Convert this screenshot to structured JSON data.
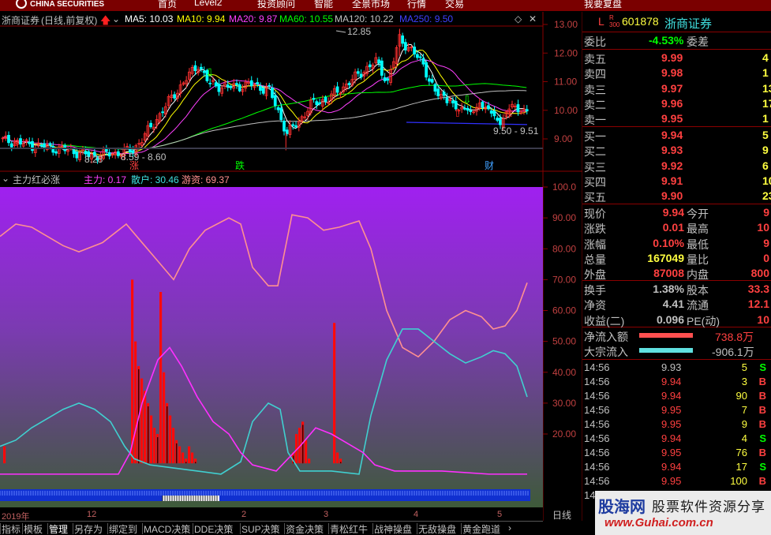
{
  "menu_bar": {
    "brand": "CHINA SECURITIES",
    "items": [
      "首页",
      "Level2",
      "投资顾问",
      "智能",
      "全景市场",
      "行情",
      "交易",
      "我要复盘"
    ]
  },
  "main_chart": {
    "title": "浙商证券",
    "period": "(日线,前复权)",
    "ma": [
      {
        "label": "MA5: 10.03",
        "color": "#ffffff"
      },
      {
        "label": "MA10: 9.94",
        "color": "#ffff00"
      },
      {
        "label": "MA20: 9.87",
        "color": "#ff40ff"
      },
      {
        "label": "MA60: 10.55",
        "color": "#00ff00"
      },
      {
        "label": "MA120: 10.22",
        "color": "#c0c0c0"
      },
      {
        "label": "MA250: 9.50",
        "color": "#4040ff"
      }
    ],
    "y_labels": [
      "13.00",
      "12.00",
      "11.00",
      "10.00",
      "9.00"
    ],
    "annotations": {
      "high": "12.85",
      "low": "8.28",
      "range1": "8.59 - 8.60",
      "range2": "9.50 - 9.51",
      "badge_zhang": "涨",
      "badge_die": "跌",
      "badge_cai": "财"
    }
  },
  "sub_chart": {
    "title": "主力红必涨",
    "legend": [
      {
        "label": "主力: 0.17",
        "color": "#ff40ff"
      },
      {
        "label": "散户: 30.46",
        "color": "#40e0e0"
      },
      {
        "label": "游资: 69.37",
        "color": "#ff9090"
      }
    ],
    "y_labels": [
      "100.0",
      "90.00",
      "80.00",
      "70.00",
      "60.00",
      "50.00",
      "40.00",
      "30.00",
      "20.00"
    ]
  },
  "x_axis": {
    "labels": [
      "2019年",
      "12",
      "2",
      "3",
      "4",
      "5"
    ],
    "period_button": "日线"
  },
  "bottom_tabs": [
    "指标",
    "模板",
    "管理",
    "另存为",
    "绑定到",
    "MACD决策",
    "DDE决策",
    "SUP决策",
    "资金决策",
    "青松红牛",
    "战神操盘",
    "无敌操盘",
    "黄金跑道"
  ],
  "quote_panel": {
    "market_flag": "L",
    "index_tag": "R 300",
    "code": "601878",
    "name": "浙商证券",
    "weibi_label": "委比",
    "weibi_value": "-4.53%",
    "weicha_label": "委差",
    "sell": [
      {
        "label": "卖五",
        "price": "9.99",
        "vol": "4"
      },
      {
        "label": "卖四",
        "price": "9.98",
        "vol": "1"
      },
      {
        "label": "卖三",
        "price": "9.97",
        "vol": "13"
      },
      {
        "label": "卖二",
        "price": "9.96",
        "vol": "17"
      },
      {
        "label": "卖一",
        "price": "9.95",
        "vol": "1"
      }
    ],
    "buy": [
      {
        "label": "买一",
        "price": "9.94",
        "vol": "5"
      },
      {
        "label": "买二",
        "price": "9.93",
        "vol": "9"
      },
      {
        "label": "买三",
        "price": "9.92",
        "vol": "6"
      },
      {
        "label": "买四",
        "price": "9.91",
        "vol": "10"
      },
      {
        "label": "买五",
        "price": "9.90",
        "vol": "23"
      }
    ],
    "stats": [
      {
        "l1": "现价",
        "v1": "9.94",
        "l2": "今开",
        "v2": "9"
      },
      {
        "l1": "涨跌",
        "v1": "0.01",
        "l2": "最高",
        "v2": "10"
      },
      {
        "l1": "涨幅",
        "v1": "0.10%",
        "l2": "最低",
        "v2": "9"
      },
      {
        "l1": "总量",
        "v1": "167049",
        "l2": "量比",
        "v2": "0"
      },
      {
        "l1": "外盘",
        "v1": "87008",
        "l2": "内盘",
        "v2": "800"
      }
    ],
    "stats2": [
      {
        "l1": "换手",
        "v1": "1.38%",
        "l2": "股本",
        "v2": "33.3"
      },
      {
        "l1": "净资",
        "v1": "4.41",
        "l2": "流通",
        "v2": "12.1"
      },
      {
        "l1": "收益(二)",
        "v1": "0.096",
        "l2": "PE(动)",
        "v2": "10"
      }
    ],
    "net_inflow_label": "净流入额",
    "net_inflow_value": "738.8万",
    "block_inflow_label": "大宗流入",
    "block_inflow_value": "-906.1万",
    "trades": [
      {
        "time": "14:56",
        "price": "9.93",
        "vol": "5",
        "side": "S"
      },
      {
        "time": "14:56",
        "price": "9.94",
        "vol": "3",
        "side": "B"
      },
      {
        "time": "14:56",
        "price": "9.94",
        "vol": "90",
        "side": "B"
      },
      {
        "time": "14:56",
        "price": "9.95",
        "vol": "7",
        "side": "B"
      },
      {
        "time": "14:56",
        "price": "9.95",
        "vol": "9",
        "side": "B"
      },
      {
        "time": "14:56",
        "price": "9.94",
        "vol": "4",
        "side": "S"
      },
      {
        "time": "14:56",
        "price": "9.95",
        "vol": "76",
        "side": "B"
      },
      {
        "time": "14:56",
        "price": "9.94",
        "vol": "17",
        "side": "S"
      },
      {
        "time": "14:56",
        "price": "9.95",
        "vol": "100",
        "side": "B"
      },
      {
        "time": "14:",
        "price": "",
        "vol": "",
        "side": ""
      }
    ]
  },
  "watermark": {
    "brand": "股海网",
    "slogan": "股票软件资源分享",
    "url": "www.Guhai.com.cn"
  },
  "colors": {
    "up": "#ff3030",
    "down": "#00ffff",
    "price_up": "#ff4040",
    "price_down": "#00e000",
    "grid": "#8b0000",
    "label": "#c0c0c0"
  }
}
